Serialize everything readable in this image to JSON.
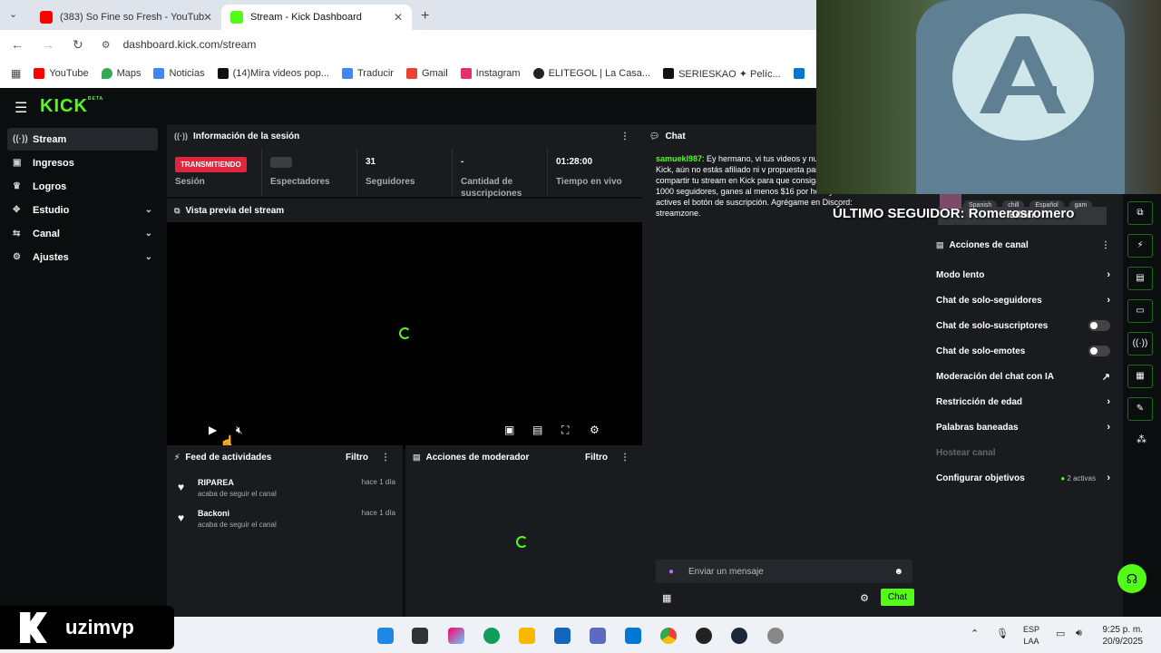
{
  "browser": {
    "tabs": [
      {
        "title": "(383) So Fine so Fresh - YouTub",
        "favicon_color": "#ff0000"
      },
      {
        "title": "Stream - Kick Dashboard",
        "favicon_color": "#53fc18"
      }
    ],
    "new_tab": "+",
    "url": "dashboard.kick.com/stream",
    "bookmarks": [
      "YouTube",
      "Maps",
      "Noticias",
      "(14)Mira videos pop...",
      "Traducir",
      "Gmail",
      "Instagram",
      "ELITEGOL | La Casa...",
      "SERIESKAO ✦ Pelíc..."
    ]
  },
  "brand": {
    "logo": "KICK",
    "beta": "BETA",
    "accent": "#53fc18"
  },
  "sidebar": {
    "items": [
      {
        "label": "Stream",
        "icon": "broadcast-icon"
      },
      {
        "label": "Ingresos",
        "icon": "money-icon"
      },
      {
        "label": "Logros",
        "icon": "trophy-icon"
      },
      {
        "label": "Estudio",
        "icon": "studio-icon"
      },
      {
        "label": "Canal",
        "icon": "channel-icon"
      },
      {
        "label": "Ajustes",
        "icon": "gear-icon"
      }
    ]
  },
  "session": {
    "title": "Información de la sesión",
    "status": "TRANSMITIENDO",
    "session_label": "Sesión",
    "viewers_label": "Espectadores",
    "followers_value": "31",
    "followers_label": "Seguidores",
    "subs_value": "-",
    "subs_label": "Cantidad de suscripciones",
    "live_value": "01:28:00",
    "live_label": "Tiempo en vivo"
  },
  "preview": {
    "title": "Vista previa del stream"
  },
  "feed": {
    "title": "Feed de actividades",
    "filter": "Filtro",
    "items": [
      {
        "name": "RIPAREA",
        "action": "acaba de seguir el canal",
        "time": "hace 1 día"
      },
      {
        "name": "Backoni",
        "action": "acaba de seguir el canal",
        "time": "hace 1 día"
      }
    ]
  },
  "mod": {
    "title": "Acciones de moderador",
    "filter": "Filtro"
  },
  "chat": {
    "title": "Chat",
    "user": "samuekl987",
    "message": ": Ey hermano, vi tus videos y nuevo en Kick, aún no estás afiliado ni v propuesta para ti: compartir tu stream en Kick para que consigas más de 1000 seguidores, ganes al menos $16 por hora y actives el botón de suscripción. Agrégame en Discord: streamzone.",
    "input_placeholder": "Enviar un mensaje",
    "send": "Chat"
  },
  "overlay": {
    "follower_text": "ÚLTIMO SEGUIDOR: Romerosromero",
    "tags": [
      "Spanish",
      "chill",
      "Español",
      "gam"
    ]
  },
  "channel": {
    "edit": "Editar",
    "title": "Acciones de canal",
    "rows": [
      {
        "label": "Modo lento",
        "control": "›"
      },
      {
        "label": "Chat de solo-seguidores",
        "control": "›"
      },
      {
        "label": "Chat de solo-suscriptores",
        "control": "toggle"
      },
      {
        "label": "Chat de solo-emotes",
        "control": "toggle"
      },
      {
        "label": "Moderación del chat con IA",
        "control": "↗"
      },
      {
        "label": "Restricción de edad",
        "control": "›"
      },
      {
        "label": "Palabras baneadas",
        "control": "›"
      },
      {
        "label": "Hostear canal",
        "control": ""
      },
      {
        "label": "Configurar objetivos",
        "control": "›",
        "extra": "2 activas"
      }
    ]
  },
  "taskbar": {
    "lang1": "ESP",
    "lang2": "LAA",
    "time": "9:25 p. m.",
    "date": "20/9/2025"
  },
  "watermark": {
    "name": "uzimvp"
  }
}
